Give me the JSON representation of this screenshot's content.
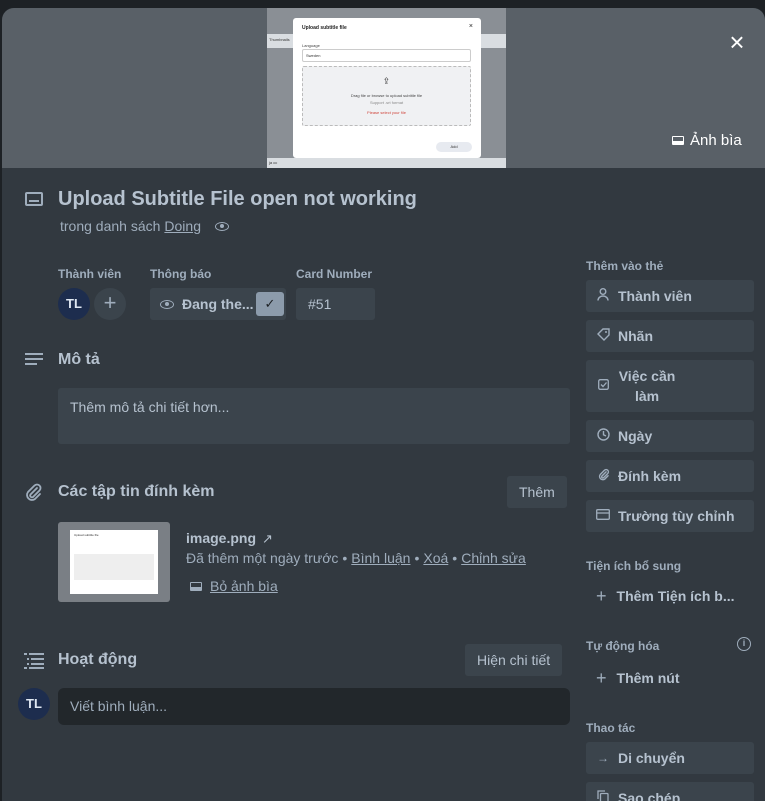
{
  "cover": {
    "button_label": "Ảnh bìa",
    "preview": {
      "dialog_title": "Upload subtitle file",
      "close": "×",
      "language_label": "Language",
      "language_value": "Sweden",
      "drop_text": "Drag file or browse to upload subtitle file",
      "support_text": "Support .srt format",
      "error_text": "Please select your file",
      "add_label": "Add",
      "top_sliver_text": "Thumbnails",
      "bottom_sliver_text": "ja cc"
    }
  },
  "close_label": "×",
  "card": {
    "title": "Upload Subtitle File open not working",
    "in_list_prefix": "trong danh sách",
    "list_name": "Doing"
  },
  "fields": {
    "members_label": "Thành viên",
    "member_initials": "TL",
    "add_member": "+",
    "notifications_label": "Thông báo",
    "watch_label": "Đang the...",
    "watch_check": "✓",
    "card_number_label": "Card Number",
    "card_number_value": "#51"
  },
  "description": {
    "title": "Mô tả",
    "placeholder": "Thêm mô tả chi tiết hơn..."
  },
  "attachments": {
    "title": "Các tập tin đính kèm",
    "add_button": "Thêm",
    "file": {
      "name": "image.png",
      "open_icon": "↗",
      "added": "Đã thêm một ngày trước",
      "comment": "Bình luận",
      "delete": "Xoá",
      "edit": "Chỉnh sửa",
      "remove_cover": "Bỏ ảnh bìa",
      "thumb_title": "Upload subtitle file"
    }
  },
  "activity": {
    "title": "Hoạt động",
    "show_details": "Hiện chi tiết",
    "user_initials": "TL",
    "comment_placeholder": "Viết bình luận..."
  },
  "sidebar": {
    "add_to_card_label": "Thêm vào thẻ",
    "add_to_card": [
      {
        "label": "Thành viên",
        "icon": "person-icon"
      },
      {
        "label": "Nhãn",
        "icon": "tag-icon"
      },
      {
        "label": "Việc cần làm",
        "icon": "checklist-icon"
      },
      {
        "label": "Ngày",
        "icon": "clock-icon"
      },
      {
        "label": "Đính kèm",
        "icon": "paperclip-icon"
      },
      {
        "label": "Trường tùy chỉnh",
        "icon": "custom-field-icon"
      }
    ],
    "powerups_label": "Tiện ích bổ sung",
    "add_powerup": "Thêm Tiện ích b...",
    "automation_label": "Tự động hóa",
    "info_icon": "i",
    "add_button": "Thêm nút",
    "actions_label": "Thao tác",
    "move": "Di chuyển",
    "copy": "Sao chép"
  }
}
